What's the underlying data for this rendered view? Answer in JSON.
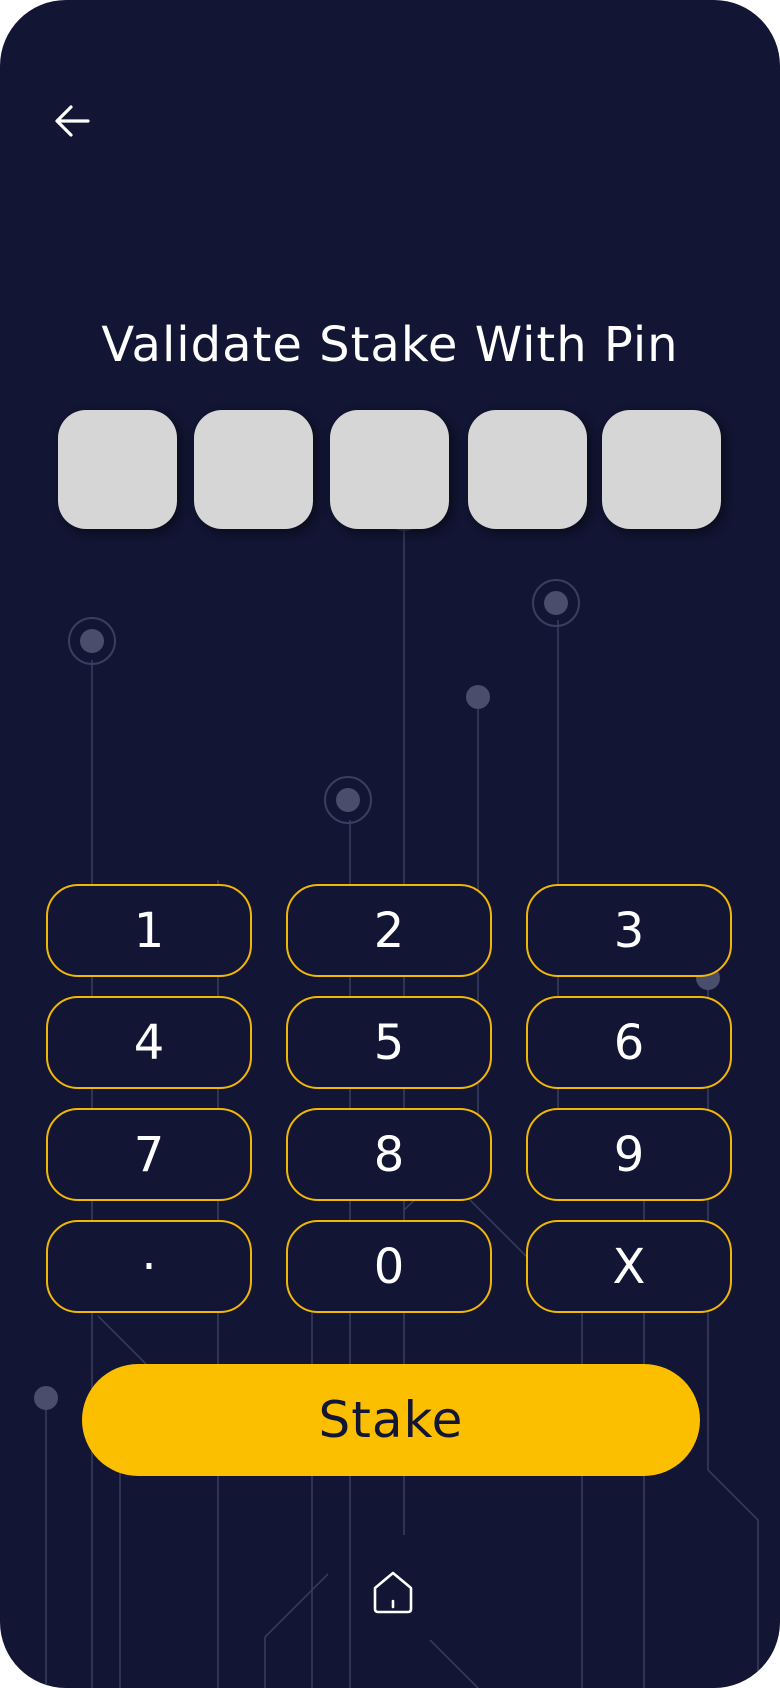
{
  "header": {
    "back_icon": "arrow-left-icon"
  },
  "title": "Validate Stake With Pin",
  "pin": {
    "length": 5,
    "entered": ""
  },
  "keypad": {
    "keys": [
      "1",
      "2",
      "3",
      "4",
      "5",
      "6",
      "7",
      "8",
      "9",
      "·",
      "0",
      "X"
    ]
  },
  "stake_button": {
    "label": "Stake"
  },
  "footer": {
    "home_icon": "home-icon"
  },
  "colors": {
    "background": "#121533",
    "accent": "#fbbf00",
    "key_border": "#f2b705",
    "pin_box": "#d6d6d6",
    "text": "#ffffff"
  }
}
